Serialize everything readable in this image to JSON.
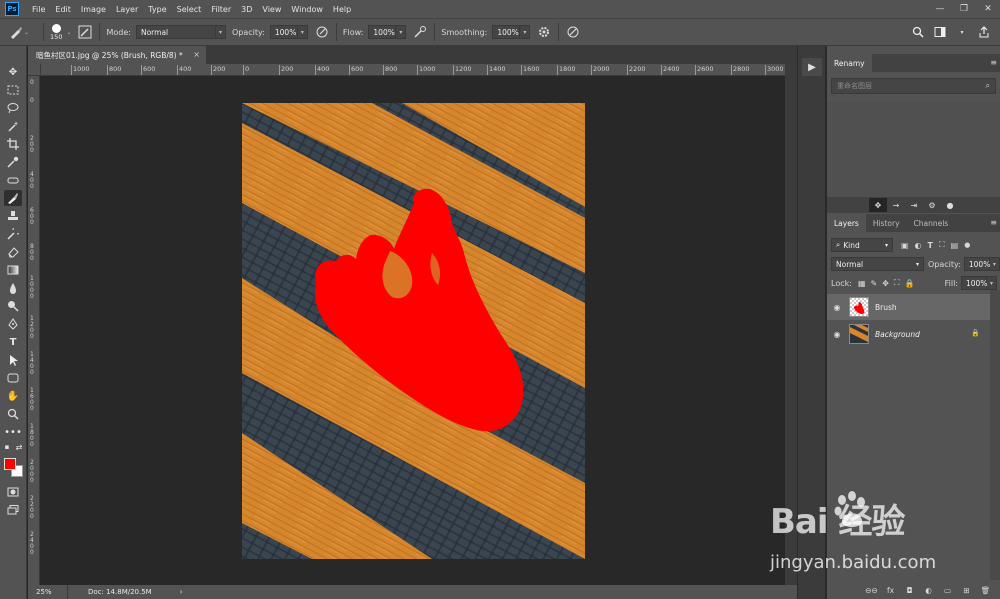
{
  "menubar": {
    "logo": "Ps",
    "items": [
      "File",
      "Edit",
      "Image",
      "Layer",
      "Type",
      "Select",
      "Filter",
      "3D",
      "View",
      "Window",
      "Help"
    ],
    "window_controls": [
      "—",
      "❐",
      "✕"
    ]
  },
  "options": {
    "brush_size": "150",
    "mode_label": "Mode:",
    "mode_value": "Normal",
    "opacity_label": "Opacity:",
    "opacity_value": "100%",
    "flow_label": "Flow:",
    "flow_value": "100%",
    "smoothing_label": "Smoothing:",
    "smoothing_value": "100%"
  },
  "document": {
    "tab_title": "暗鱼村区01.jpg @ 25% (Brush, RGB/8) *",
    "close": "×"
  },
  "ruler": {
    "h_labels": [
      "1000",
      "800",
      "600",
      "400",
      "200",
      "0",
      "200",
      "400",
      "600",
      "800",
      "1000",
      "1200",
      "1400",
      "1600",
      "1800",
      "2000",
      "2200",
      "2400",
      "2600",
      "2800",
      "3000",
      "3200",
      "3400",
      "3600",
      "3800"
    ],
    "v_labels": [
      "0",
      "0",
      "2 0 0",
      "4 0 0",
      "6 0 0",
      "8 0 0",
      "1 0 0 0",
      "1 2 0 0",
      "1 4 0 0",
      "1 6 0 0",
      "1 8 0 0",
      "2 0 0 0",
      "2 2 0 0",
      "2 4 0 0",
      "2 6 0 0",
      "2 8 0 0",
      "3 0 0 0",
      "3 2 0 0"
    ]
  },
  "status": {
    "zoom": "25%",
    "doc": "Doc: 14.8M/20.5M",
    "arrow": "›"
  },
  "panels": {
    "top_tab": "Renamy",
    "search_placeholder": "重命名图层",
    "layers_tabs": [
      "Layers",
      "History",
      "Channels"
    ],
    "kind_label": "Kind",
    "blend_mode": "Normal",
    "opacity_label": "Opacity:",
    "opacity_value": "100%",
    "lock_label": "Lock:",
    "fill_label": "Fill:",
    "fill_value": "100%",
    "layers": [
      {
        "name": "Brush"
      },
      {
        "name": "Background"
      }
    ],
    "bottom_icons": [
      "⊖⊖",
      "fx",
      "◘",
      "◐",
      "▭",
      "⊞",
      "🗑"
    ]
  },
  "watermark": {
    "brand": "Bai 经验",
    "url": "jingyan.baidu.com"
  },
  "colors": {
    "foreground": "#ff0000",
    "background": "#ffffff",
    "ui_panel": "#535353",
    "canvas": "#282828",
    "stripe_orange": "#d8892e",
    "cobble_dark": "#2a333c"
  }
}
